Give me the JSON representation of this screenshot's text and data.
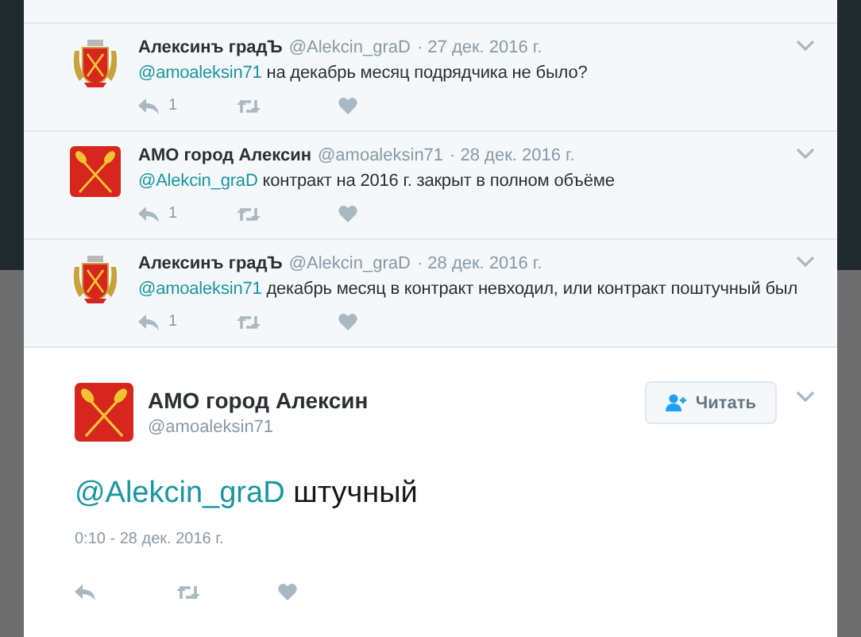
{
  "replies": [
    {
      "kind": "crest",
      "name": "Алексинъ градЪ",
      "handle": "@Alekcin_graD",
      "date": "· 27 дек. 2016 г.",
      "mention": "@amoaleksin71",
      "text": "на декабрь месяц подрядчика не было?",
      "reply_count": "1"
    },
    {
      "kind": "oars",
      "name": "АМО город Алексин",
      "handle": "@amoaleksin71",
      "date": "· 28 дек. 2016 г.",
      "mention": "@Alekcin_graD",
      "text": "контракт на 2016 г. закрыт в полном объёме",
      "reply_count": "1"
    },
    {
      "kind": "crest",
      "name": "Алексинъ градЪ",
      "handle": "@Alekcin_graD",
      "date": "· 28 дек. 2016 г.",
      "mention": "@amoaleksin71",
      "text": "декабрь месяц в контракт невходил, или контракт поштучный был",
      "reply_count": "1"
    }
  ],
  "main": {
    "kind": "oars",
    "name": "АМО город Алексин",
    "handle": "@amoaleksin71",
    "follow_label": "Читать",
    "mention": "@Alekcin_graD",
    "text": "штучный",
    "timestamp": "0:10 - 28 дек. 2016 г."
  }
}
